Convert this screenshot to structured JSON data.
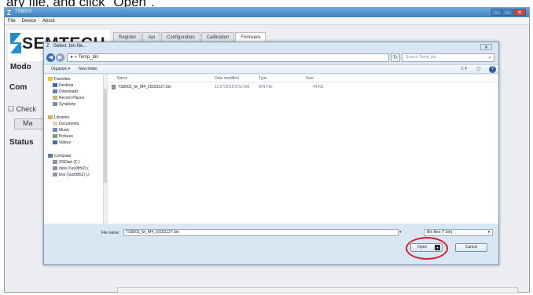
{
  "caption": "ary file, and click \"Open\".",
  "app": {
    "icon_glyph": "Z",
    "title": "TS8003",
    "menu": [
      "File",
      "Device",
      "About"
    ],
    "window_buttons": [
      "–",
      "▫",
      "✕"
    ],
    "logo_text": "SEMTECH",
    "tabs": [
      "Register",
      "Api",
      "Configuration",
      "Calibration",
      "Firmware"
    ],
    "active_tab": "Firmware",
    "left_panel": {
      "mode_label": "Modo",
      "com_label": "Com",
      "check_label": "Check",
      "button_label": "Ma",
      "status_label": "Status"
    }
  },
  "dialog": {
    "icon_glyph": "Z",
    "title": "Select .bin file...",
    "close_glyph": "✕",
    "nav_back_glyph": "◀",
    "nav_forward_glyph": "▶",
    "address_path": "▸ « Temp_bin",
    "refresh_glyph": "↻",
    "search_placeholder": "Search Temp_bin",
    "toolbar": {
      "organize": "Organize ▾",
      "new_folder": "New folder",
      "views_glyph": "≡ ▾",
      "pane_glyph": "◫",
      "help_glyph": "?"
    },
    "nav": {
      "favorites": "Favorites",
      "desktop": "Desktop",
      "downloads": "Downloads",
      "recent_places": "Recent Places",
      "synplicity": "Synplicity",
      "libraries": "Libraries",
      "documents": "Documents",
      "music": "Music",
      "pictures": "Pictures",
      "videos": "Videos",
      "computer": "Computer",
      "osdisk": "OSDisk (C:)",
      "drive_data": "data (\\\\us08fs2) (",
      "drive_test": "test (\\\\us08fs2) (J"
    },
    "columns": [
      "Name",
      "Date modified",
      "Type",
      "Size"
    ],
    "files": [
      {
        "name": "TS8003_fw_M4_20181127.bin",
        "date": "11/27/2018 8:52 AM",
        "type": "BIN File",
        "size": "44 KB"
      }
    ],
    "filename_label": "File name:",
    "filename_value": "TS8003_fw_M4_20181127.bin",
    "filter_value": "Bin files (*.bin)",
    "open_label": "Open",
    "cancel_label": "Cancel",
    "dropdown_glyph": "▾"
  },
  "colors": {
    "annotation_ring": "#d3222a",
    "titlebar_blue": "#3f7fbd",
    "dialog_frame": "#d9e7f4"
  }
}
